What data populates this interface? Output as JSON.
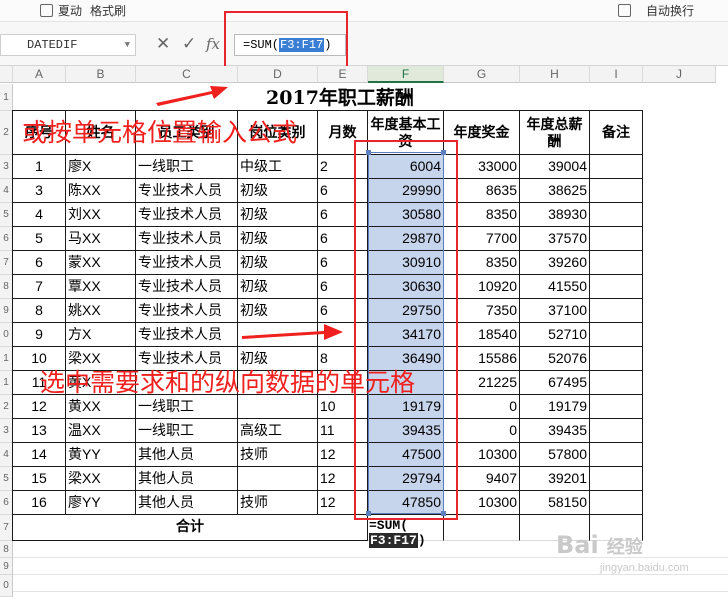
{
  "toolbar": {
    "items": [
      "夏动",
      "格式刷",
      "自动换行"
    ]
  },
  "formula_bar": {
    "name_box": "DATEDIF",
    "cancel_icon": "✕",
    "confirm_icon": "✓",
    "fx_icon": "fx",
    "formula_prefix": "=SUM(",
    "formula_range": "F3:F17",
    "formula_suffix": ")"
  },
  "columns": [
    "A",
    "B",
    "C",
    "D",
    "E",
    "F",
    "G",
    "H",
    "I",
    "J"
  ],
  "rows": [
    "1",
    "2",
    "3",
    "4",
    "5",
    "6",
    "7",
    "8",
    "9",
    "0",
    "1",
    "1",
    "2",
    "3",
    "4",
    "5",
    "6",
    "7",
    "8",
    "9",
    "0"
  ],
  "sheet": {
    "title": "2017年职工薪酬",
    "headers": {
      "seq": "序号",
      "name": "姓名",
      "personnel": "员工类别",
      "position": "岗位类别",
      "months": "月数",
      "base": "年度基本工资",
      "bonus": "年度奖金",
      "total": "年度总薪酬",
      "note": "备注"
    },
    "data": [
      {
        "seq": "1",
        "name": "廖X",
        "personnel": "一线职工",
        "position": "中级工",
        "months": "2",
        "base": "6004",
        "bonus": "33000",
        "total": "39004"
      },
      {
        "seq": "3",
        "name": "陈XX",
        "personnel": "专业技术人员",
        "position": "初级",
        "months": "6",
        "base": "29990",
        "bonus": "8635",
        "total": "38625"
      },
      {
        "seq": "4",
        "name": "刘XX",
        "personnel": "专业技术人员",
        "position": "初级",
        "months": "6",
        "base": "30580",
        "bonus": "8350",
        "total": "38930"
      },
      {
        "seq": "5",
        "name": "马XX",
        "personnel": "专业技术人员",
        "position": "初级",
        "months": "6",
        "base": "29870",
        "bonus": "7700",
        "total": "37570"
      },
      {
        "seq": "6",
        "name": "蒙XX",
        "personnel": "专业技术人员",
        "position": "初级",
        "months": "6",
        "base": "30910",
        "bonus": "8350",
        "total": "39260"
      },
      {
        "seq": "7",
        "name": "覃XX",
        "personnel": "专业技术人员",
        "position": "初级",
        "months": "6",
        "base": "30630",
        "bonus": "10920",
        "total": "41550"
      },
      {
        "seq": "8",
        "name": "姚XX",
        "personnel": "专业技术人员",
        "position": "初级",
        "months": "6",
        "base": "29750",
        "bonus": "7350",
        "total": "37100"
      },
      {
        "seq": "9",
        "name": "方X",
        "personnel": "专业技术人员",
        "position": "",
        "months": "",
        "base": "34170",
        "bonus": "18540",
        "total": "52710"
      },
      {
        "seq": "10",
        "name": "梁XX",
        "personnel": "专业技术人员",
        "position": "初级",
        "months": "8",
        "base": "36490",
        "bonus": "15586",
        "total": "52076"
      },
      {
        "seq": "11",
        "name": "黄X",
        "personnel": "",
        "position": "",
        "months": "",
        "base": "",
        "bonus": "21225",
        "total": "67495"
      },
      {
        "seq": "12",
        "name": "黄XX",
        "personnel": "一线职工",
        "position": "",
        "months": "10",
        "base": "19179",
        "bonus": "0",
        "total": "19179"
      },
      {
        "seq": "13",
        "name": "温XX",
        "personnel": "一线职工",
        "position": "高级工",
        "months": "11",
        "base": "39435",
        "bonus": "0",
        "total": "39435"
      },
      {
        "seq": "14",
        "name": "黄YY",
        "personnel": "其他人员",
        "position": "技师",
        "months": "12",
        "base": "47500",
        "bonus": "10300",
        "total": "57800"
      },
      {
        "seq": "15",
        "name": "梁XX",
        "personnel": "其他人员",
        "position": "",
        "months": "12",
        "base": "29794",
        "bonus": "9407",
        "total": "39201"
      },
      {
        "seq": "16",
        "name": "廖YY",
        "personnel": "其他人员",
        "position": "技师",
        "months": "12",
        "base": "47850",
        "bonus": "10300",
        "total": "58150"
      }
    ],
    "total_label": "合计",
    "total_formula_line1": "=SUM(",
    "total_formula_range": "F3:F17",
    "total_formula_suffix": ")"
  },
  "annotations": {
    "top": "或按单元格位置输入公式",
    "bottom": "选中需要求和的纵向数据的单元格",
    "color": "#f0201e"
  },
  "watermark": {
    "brand": "Bai",
    "brand_suffix": "经验",
    "url": "jingyan.baidu.com"
  }
}
